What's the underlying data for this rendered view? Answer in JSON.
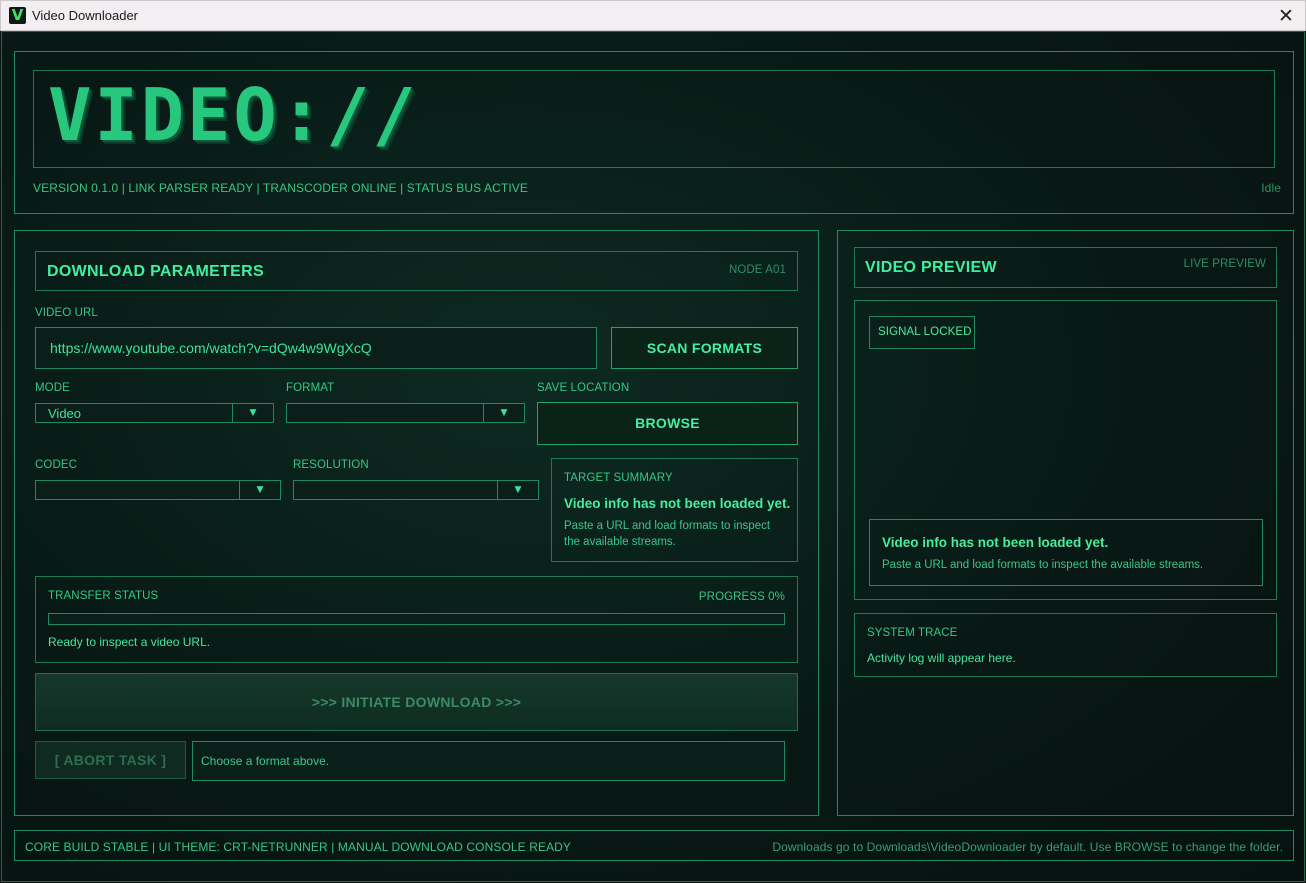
{
  "window": {
    "title": "Video Downloader",
    "logo_glyph": "V",
    "close_glyph": "✕"
  },
  "banner": {
    "logo_text": "VIDEO://",
    "status_line": "VERSION 0.1.0 | LINK PARSER READY | TRANSCODER ONLINE | STATUS BUS ACTIVE",
    "state": "Idle"
  },
  "params": {
    "heading": "DOWNLOAD PARAMETERS",
    "node": "NODE A01",
    "url_label": "VIDEO URL",
    "url_value": "https://www.youtube.com/watch?v=dQw4w9WgXcQ",
    "scan_label": "SCAN FORMATS",
    "mode_label": "MODE",
    "mode_value": "Video",
    "format_label": "FORMAT",
    "format_value": "",
    "save_label": "SAVE LOCATION",
    "browse_label": "BROWSE",
    "codec_label": "CODEC",
    "codec_value": "",
    "resolution_label": "RESOLUTION",
    "resolution_value": "",
    "summary_label": "TARGET SUMMARY",
    "summary_title": "Video info has not been loaded yet.",
    "summary_text": "Paste a URL and load formats to inspect the available streams."
  },
  "transfer": {
    "label": "TRANSFER STATUS",
    "progress_label": "PROGRESS 0%",
    "progress": 0,
    "message": "Ready to inspect a video URL."
  },
  "actions": {
    "download_label": ">>> INITIATE DOWNLOAD >>>",
    "abort_label": "[ ABORT TASK ]",
    "hint": "Choose a format above."
  },
  "preview": {
    "heading": "VIDEO PREVIEW",
    "tag": "LIVE PREVIEW",
    "signal": "SIGNAL LOCKED",
    "info_title": "Video info has not been loaded yet.",
    "info_text": "Paste a URL and load formats to inspect the available streams."
  },
  "trace": {
    "label": "SYSTEM TRACE",
    "text": "Activity log will appear here."
  },
  "footer": {
    "left": "CORE BUILD STABLE | UI THEME: CRT-NETRUNNER | MANUAL DOWNLOAD CONSOLE READY",
    "right": "Downloads go to Downloads\\VideoDownloader by default. Use BROWSE to change the folder."
  },
  "colors": {
    "accent": "#2fd98a",
    "background": "#071410",
    "border": "#1f8a5f"
  },
  "icons": {
    "dropdown": "chevron-down-icon",
    "close": "close-icon",
    "logo": "app-logo-icon"
  }
}
